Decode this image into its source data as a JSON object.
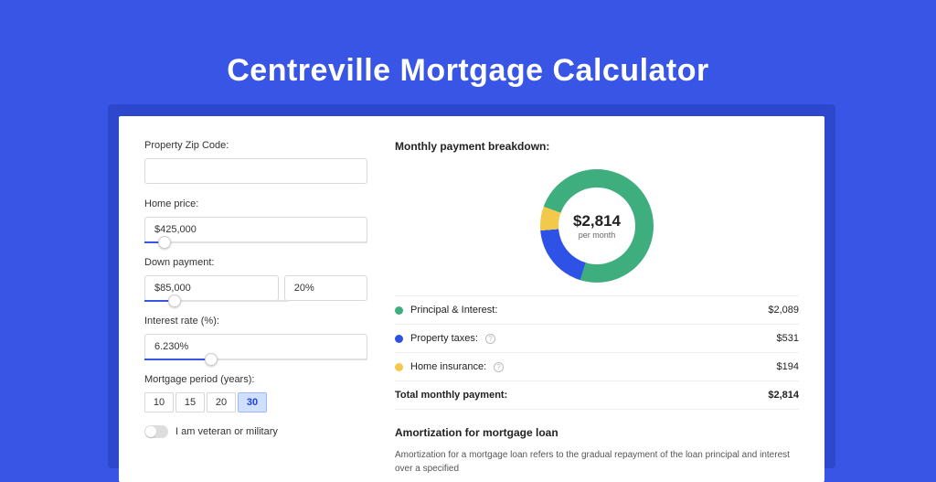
{
  "page": {
    "title": "Centreville Mortgage Calculator"
  },
  "form": {
    "zip": {
      "label": "Property Zip Code:",
      "value": ""
    },
    "homePrice": {
      "label": "Home price:",
      "value": "$425,000",
      "sliderPct": 9
    },
    "downPayment": {
      "label": "Down payment:",
      "amount": "$85,000",
      "percent": "20%",
      "sliderPct": 21
    },
    "interestRate": {
      "label": "Interest rate (%):",
      "value": "6.230%",
      "sliderPct": 30
    },
    "period": {
      "label": "Mortgage period (years):",
      "options": [
        "10",
        "15",
        "20",
        "30"
      ],
      "active": "30"
    },
    "veteran": {
      "label": "I am veteran or military",
      "on": false
    }
  },
  "breakdown": {
    "title": "Monthly payment breakdown:",
    "donut": {
      "amount": "$2,814",
      "caption": "per month"
    },
    "items": [
      {
        "label": "Principal & Interest:",
        "value": "$2,089",
        "color": "#3fae7f",
        "info": false
      },
      {
        "label": "Property taxes:",
        "value": "$531",
        "color": "#2e52e6",
        "info": true
      },
      {
        "label": "Home insurance:",
        "value": "$194",
        "color": "#f3c94b",
        "info": true
      }
    ],
    "total": {
      "label": "Total monthly payment:",
      "value": "$2,814"
    }
  },
  "amort": {
    "title": "Amortization for mortgage loan",
    "text": "Amortization for a mortgage loan refers to the gradual repayment of the loan principal and interest over a specified"
  },
  "colors": {
    "green": "#3fae7f",
    "blue": "#2e52e6",
    "yellow": "#f3c94b"
  },
  "chart_data": {
    "type": "pie",
    "title": "Monthly payment breakdown",
    "center_label": "$2,814 per month",
    "series": [
      {
        "name": "Principal & Interest",
        "value": 2089,
        "color": "#3fae7f"
      },
      {
        "name": "Property taxes",
        "value": 531,
        "color": "#2e52e6"
      },
      {
        "name": "Home insurance",
        "value": 194,
        "color": "#f3c94b"
      }
    ],
    "total": 2814
  }
}
